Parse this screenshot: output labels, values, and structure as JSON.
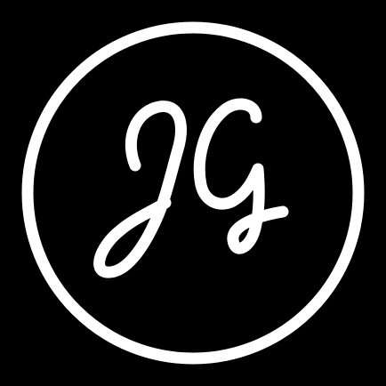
{
  "logo": {
    "monogram": "JG",
    "colors": {
      "background": "#000000",
      "foreground": "#ffffff"
    }
  }
}
